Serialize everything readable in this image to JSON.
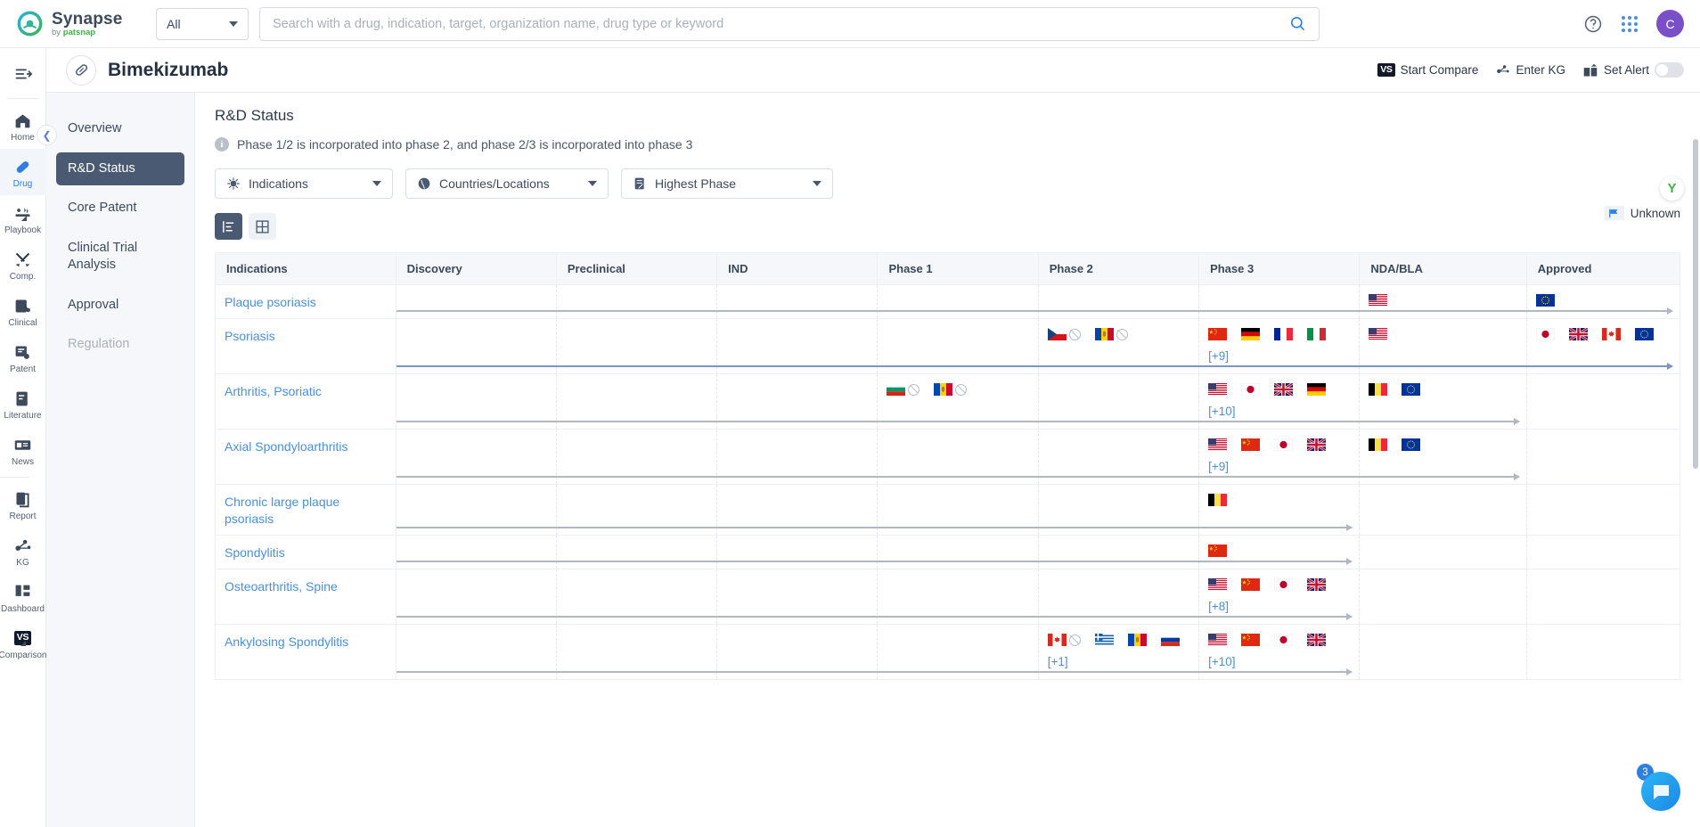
{
  "brand": {
    "name": "Synapse",
    "by": "by ",
    "sub": "patsnap"
  },
  "topbar": {
    "scope_value": "All",
    "search_placeholder": "Search with a drug, indication, target, organization name, drug type or keyword",
    "icons": [
      "help-icon",
      "apps-grid-icon"
    ],
    "avatar_initial": "C"
  },
  "rail": {
    "toggle": "collapse-rail-icon",
    "items": [
      {
        "label": "Home",
        "icon": "home-icon",
        "active": false
      },
      {
        "label": "Drug",
        "icon": "capsule-icon",
        "active": true
      },
      {
        "label": "Playbook",
        "icon": "playbook-icon",
        "active": false,
        "corner": true
      },
      {
        "label": "Comp.",
        "icon": "swords-icon",
        "active": false
      },
      {
        "label": "Clinical",
        "icon": "clinical-icon",
        "active": false
      },
      {
        "label": "Patent",
        "icon": "patent-icon",
        "active": false
      },
      {
        "label": "Literature",
        "icon": "literature-icon",
        "active": false
      },
      {
        "label": "News",
        "icon": "news-icon",
        "active": false
      },
      {
        "label": "Report",
        "icon": "report-icon",
        "active": false
      },
      {
        "label": "KG",
        "icon": "knowledge-graph-icon",
        "active": false
      },
      {
        "label": "Dashboard",
        "icon": "dashboard-icon",
        "active": false
      },
      {
        "label": "Comparison",
        "icon": "vs-icon",
        "active": false,
        "corner": true
      }
    ]
  },
  "drug_header": {
    "title": "Bimekizumab",
    "actions": [
      {
        "label": "Start Compare",
        "icon": "vs-icon"
      },
      {
        "label": "Enter KG",
        "icon": "knowledge-graph-icon"
      },
      {
        "label": "Set Alert",
        "icon": "alert-mail-icon"
      }
    ],
    "alert_toggle_on": false
  },
  "subnav": {
    "items": [
      {
        "label": "Overview",
        "state": "normal"
      },
      {
        "label": "R&D Status",
        "state": "active"
      },
      {
        "label": "Core Patent",
        "state": "normal"
      },
      {
        "label": "Clinical Trial Analysis",
        "state": "normal"
      },
      {
        "label": "Approval",
        "state": "normal"
      },
      {
        "label": "Regulation",
        "state": "disabled"
      }
    ],
    "collapse_icon": "chevron-left-icon"
  },
  "main": {
    "page_title": "R&D Status",
    "note": "Phase 1/2 is incorporated into phase 2, and phase 2/3 is incorporated into phase 3",
    "filters": [
      {
        "label": "Indications",
        "icon": "virus-icon"
      },
      {
        "label": "Countries/Locations",
        "icon": "globe-icon"
      },
      {
        "label": "Highest Phase",
        "icon": "phase-icon"
      }
    ],
    "view_modes": [
      {
        "name": "list-view",
        "active": true
      },
      {
        "name": "grid-view",
        "active": false
      }
    ],
    "legend": {
      "label": "Unknown",
      "icon": "flag-icon"
    },
    "assistant_badge": "Y"
  },
  "table": {
    "columns": [
      "Indications",
      "Discovery",
      "Preclinical",
      "IND",
      "Phase 1",
      "Phase 2",
      "Phase 3",
      "NDA/BLA",
      "Approved"
    ],
    "rows": [
      {
        "indication": "Plaque psoriasis",
        "arrow_from": 1,
        "arrow_to": 8,
        "arrow_color": "gray",
        "cells": {
          "NDA/BLA": {
            "flags": [
              {
                "country": "United States",
                "code": "us",
                "stopped": false
              }
            ]
          },
          "Approved": {
            "flags": [
              {
                "country": "European Union",
                "code": "eu",
                "stopped": false
              }
            ]
          }
        }
      },
      {
        "indication": "Psoriasis",
        "arrow_from": 1,
        "arrow_to": 8,
        "arrow_color": "blue",
        "cells": {
          "Phase 2": {
            "flags": [
              {
                "country": "Czech Republic",
                "code": "cz",
                "stopped": true
              },
              {
                "country": "Moldova",
                "code": "md",
                "stopped": true
              }
            ]
          },
          "Phase 3": {
            "flags": [
              {
                "country": "China",
                "code": "cn",
                "stopped": false
              },
              {
                "country": "Germany",
                "code": "de",
                "stopped": false
              },
              {
                "country": "France",
                "code": "fr",
                "stopped": false
              },
              {
                "country": "Italy",
                "code": "it",
                "stopped": false
              }
            ],
            "more": "[+9]"
          },
          "NDA/BLA": {
            "flags": [
              {
                "country": "United States",
                "code": "us",
                "stopped": false
              }
            ]
          },
          "Approved": {
            "flags": [
              {
                "country": "Japan",
                "code": "jp",
                "stopped": false
              },
              {
                "country": "United Kingdom",
                "code": "gb",
                "stopped": false
              },
              {
                "country": "Canada",
                "code": "ca",
                "stopped": false
              },
              {
                "country": "European Union",
                "code": "eu",
                "stopped": false
              }
            ]
          }
        }
      },
      {
        "indication": "Arthritis, Psoriatic",
        "arrow_from": 1,
        "arrow_to": 7,
        "arrow_color": "gray",
        "cells": {
          "Phase 1": {
            "flags": [
              {
                "country": "Bulgaria",
                "code": "bg",
                "stopped": true
              },
              {
                "country": "Moldova",
                "code": "md",
                "stopped": true
              }
            ]
          },
          "Phase 3": {
            "flags": [
              {
                "country": "United States",
                "code": "us",
                "stopped": false
              },
              {
                "country": "Japan",
                "code": "jp",
                "stopped": false
              },
              {
                "country": "United Kingdom",
                "code": "gb",
                "stopped": false
              },
              {
                "country": "Germany",
                "code": "de",
                "stopped": false
              }
            ],
            "more": "[+10]"
          },
          "NDA/BLA": {
            "flags": [
              {
                "country": "Belgium",
                "code": "be",
                "stopped": false
              },
              {
                "country": "European Union",
                "code": "eu",
                "stopped": false
              }
            ]
          }
        }
      },
      {
        "indication": "Axial Spondyloarthritis",
        "arrow_from": 1,
        "arrow_to": 7,
        "arrow_color": "gray",
        "cells": {
          "Phase 3": {
            "flags": [
              {
                "country": "United States",
                "code": "us",
                "stopped": false
              },
              {
                "country": "China",
                "code": "cn",
                "stopped": false
              },
              {
                "country": "Japan",
                "code": "jp",
                "stopped": false
              },
              {
                "country": "United Kingdom",
                "code": "gb",
                "stopped": false
              }
            ],
            "more": "[+9]"
          },
          "NDA/BLA": {
            "flags": [
              {
                "country": "Belgium",
                "code": "be",
                "stopped": false
              },
              {
                "country": "European Union",
                "code": "eu",
                "stopped": false
              }
            ]
          }
        }
      },
      {
        "indication": "Chronic large plaque psoriasis",
        "arrow_from": 1,
        "arrow_to": 6,
        "arrow_color": "gray",
        "cells": {
          "Phase 3": {
            "flags": [
              {
                "country": "Belgium",
                "code": "be",
                "stopped": false
              }
            ]
          }
        }
      },
      {
        "indication": "Spondylitis",
        "arrow_from": 1,
        "arrow_to": 6,
        "arrow_color": "gray",
        "cells": {
          "Phase 3": {
            "flags": [
              {
                "country": "China",
                "code": "cn",
                "stopped": false
              }
            ]
          }
        }
      },
      {
        "indication": "Osteoarthritis, Spine",
        "arrow_from": 1,
        "arrow_to": 6,
        "arrow_color": "gray",
        "cells": {
          "Phase 3": {
            "flags": [
              {
                "country": "United States",
                "code": "us",
                "stopped": false
              },
              {
                "country": "China",
                "code": "cn",
                "stopped": false
              },
              {
                "country": "Japan",
                "code": "jp",
                "stopped": false
              },
              {
                "country": "United Kingdom",
                "code": "gb",
                "stopped": false
              }
            ],
            "more": "[+8]"
          }
        }
      },
      {
        "indication": "Ankylosing Spondylitis",
        "arrow_from": 1,
        "arrow_to": 6,
        "arrow_color": "gray",
        "cells": {
          "Phase 2": {
            "flags": [
              {
                "country": "Canada",
                "code": "ca",
                "stopped": true
              },
              {
                "country": "Greece",
                "code": "gr",
                "stopped": false
              },
              {
                "country": "Moldova",
                "code": "md",
                "stopped": false
              },
              {
                "country": "Russia",
                "code": "ru",
                "stopped": false
              }
            ],
            "more": "[+1]"
          },
          "Phase 3": {
            "flags": [
              {
                "country": "United States",
                "code": "us",
                "stopped": false
              },
              {
                "country": "China",
                "code": "cn",
                "stopped": false
              },
              {
                "country": "Japan",
                "code": "jp",
                "stopped": false
              },
              {
                "country": "United Kingdom",
                "code": "gb",
                "stopped": false
              }
            ],
            "more": "[+10]"
          }
        }
      }
    ]
  },
  "chat": {
    "badge": "3",
    "icon": "chat-icon"
  },
  "colors": {
    "accent_blue": "#4a90d9",
    "nav_active": "#4a5a72",
    "brand_green": "#3cb44a",
    "brand_blue": "#1aa3e8"
  }
}
